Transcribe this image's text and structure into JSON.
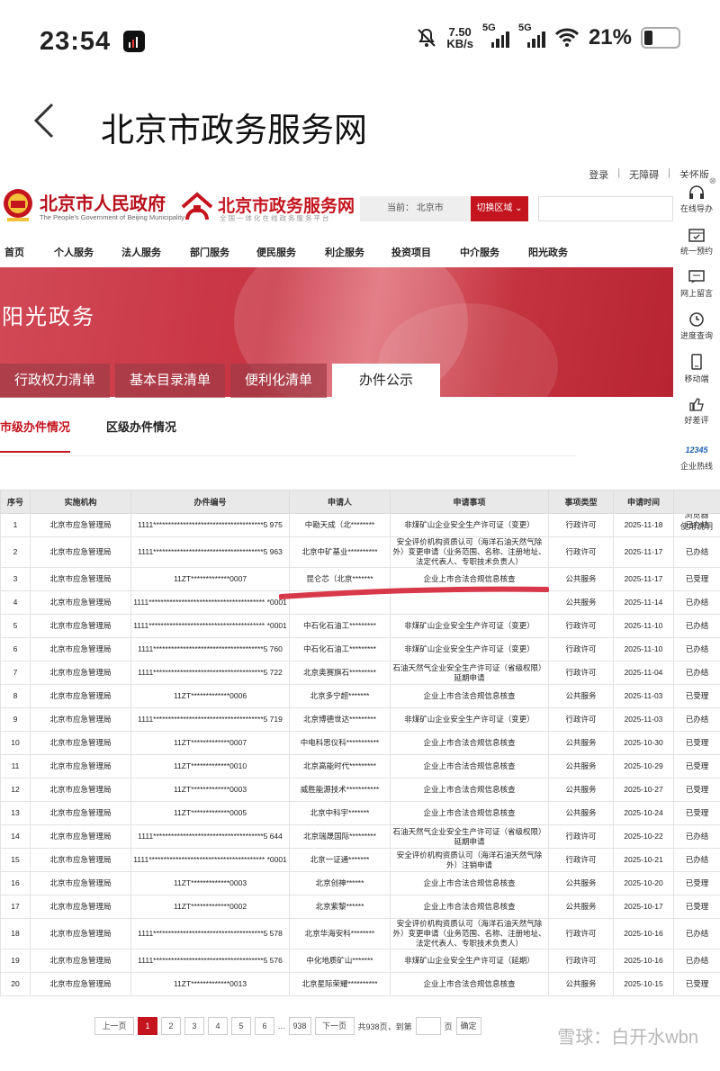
{
  "status_bar": {
    "time": "23:54",
    "speed_value": "7.50",
    "speed_unit": "KB/s",
    "signal1": "5G",
    "signal2": "5G",
    "battery": "21%"
  },
  "header": {
    "title": "北京市政务服务网"
  },
  "site": {
    "top_links": [
      "登录",
      "无障碍",
      "关怀版"
    ],
    "gov_name": "北京市人民政府",
    "gov_en": "The People's Government of Beijing Municipality",
    "service_name": "北京市政务服务网",
    "service_sub": "全国一体化在线政务服务平台",
    "region_label": "当前：",
    "region_value": "北京市",
    "region_button": "切换区域",
    "nav": [
      "首页",
      "个人服务",
      "法人服务",
      "部门服务",
      "便民服务",
      "利企服务",
      "投资项目",
      "中介服务",
      "阳光政务"
    ],
    "banner_title": "阳光政务",
    "tabs": [
      "行政权力清单",
      "基本目录清单",
      "便利化清单",
      "办件公示"
    ],
    "subtabs": [
      "市级办件情况",
      "区级办件情况"
    ],
    "sidebar": [
      "在线导办",
      "统一预约",
      "网上留言",
      "进度查询",
      "移动端",
      "好差评",
      "企业热线",
      "浏览器",
      "使用说明"
    ],
    "sidebar_badge": "12345"
  },
  "table": {
    "headers": [
      "序号",
      "实施机构",
      "办件编号",
      "申请人",
      "申请事项",
      "事项类型",
      "申请时间",
      ""
    ],
    "rows": [
      [
        "1",
        "北京市应急管理局",
        "1111*************************************5 975",
        "中勘天成（北********",
        "非煤矿山企业安全生产许可证（变更）",
        "行政许可",
        "2025-11-18",
        "已办结"
      ],
      [
        "2",
        "北京市应急管理局",
        "1111*************************************5 963",
        "北京中矿基业**********",
        "安全评价机构资质认可（海洋石油天然气除外）变更申请（业务范围、名称、注册地址、法定代表人、专职技术负责人）",
        "行政许可",
        "2025-11-17",
        "已办结"
      ],
      [
        "3",
        "北京市应急管理局",
        "11ZT*************0007",
        "昆仑芯（北京*******",
        "企业上市合法合规信息核查",
        "公共服务",
        "2025-11-17",
        "已受理"
      ],
      [
        "4",
        "北京市应急管理局",
        "1111*************************************** *0001",
        "",
        "",
        "公共服务",
        "2025-11-14",
        "已办结"
      ],
      [
        "5",
        "北京市应急管理局",
        "1111*************************************** *0001",
        "中石化石油工*********",
        "非煤矿山企业安全生产许可证（变更）",
        "行政许可",
        "2025-11-10",
        "已办结"
      ],
      [
        "6",
        "北京市应急管理局",
        "1111*************************************5 760",
        "中石化石油工*********",
        "非煤矿山企业安全生产许可证（变更）",
        "行政许可",
        "2025-11-10",
        "已办结"
      ],
      [
        "7",
        "北京市应急管理局",
        "1111*************************************5 722",
        "北京奥赛旗石*********",
        "石油天然气企业安全生产许可证（省级权限）延期申请",
        "行政许可",
        "2025-11-04",
        "已办结"
      ],
      [
        "8",
        "北京市应急管理局",
        "11ZT*************0006",
        "北京多宁超*******",
        "企业上市合法合规信息核查",
        "公共服务",
        "2025-11-03",
        "已受理"
      ],
      [
        "9",
        "北京市应急管理局",
        "1111*************************************5 719",
        "北京博德世达*********",
        "非煤矿山企业安全生产许可证（变更）",
        "行政许可",
        "2025-11-03",
        "已办结"
      ],
      [
        "10",
        "北京市应急管理局",
        "11ZT*************0007",
        "中电科思仪科***********",
        "企业上市合法合规信息核查",
        "公共服务",
        "2025-10-30",
        "已受理"
      ],
      [
        "11",
        "北京市应急管理局",
        "11ZT*************0010",
        "北京高能时代*********",
        "企业上市合法合规信息核查",
        "公共服务",
        "2025-10-29",
        "已受理"
      ],
      [
        "12",
        "北京市应急管理局",
        "11ZT*************0003",
        "威胜能源技术***********",
        "企业上市合法合规信息核查",
        "公共服务",
        "2025-10-27",
        "已受理"
      ],
      [
        "13",
        "北京市应急管理局",
        "11ZT*************0005",
        "北京中科宇*******",
        "企业上市合法合规信息核查",
        "公共服务",
        "2025-10-24",
        "已受理"
      ],
      [
        "14",
        "北京市应急管理局",
        "1111*************************************5 644",
        "北京瑞晟国际*********",
        "石油天然气企业安全生产许可证（省级权限）延期申请",
        "行政许可",
        "2025-10-22",
        "已办结"
      ],
      [
        "15",
        "北京市应急管理局",
        "1111*************************************** *0001",
        "北京一证通*******",
        "安全评价机构资质认可（海洋石油天然气除外）注销申请",
        "行政许可",
        "2025-10-21",
        "已办结"
      ],
      [
        "16",
        "北京市应急管理局",
        "11ZT*************0003",
        "北京创神******",
        "企业上市合法合规信息核查",
        "公共服务",
        "2025-10-20",
        "已受理"
      ],
      [
        "17",
        "北京市应急管理局",
        "11ZT*************0002",
        "北京紫黎******",
        "企业上市合法合规信息核查",
        "公共服务",
        "2025-10-17",
        "已受理"
      ],
      [
        "18",
        "北京市应急管理局",
        "1111*************************************5 578",
        "北京华海安科********",
        "安全评价机构资质认可（海洋石油天然气除外）变更申请（业务范围、名称、注册地址、法定代表人、专职技术负责人）",
        "行政许可",
        "2025-10-16",
        "已办结"
      ],
      [
        "19",
        "北京市应急管理局",
        "1111*************************************5 576",
        "中化地质矿山*******",
        "非煤矿山企业安全生产许可证（延期）",
        "行政许可",
        "2025-10-16",
        "已办结"
      ],
      [
        "20",
        "北京市应急管理局",
        "11ZT*************0013",
        "北京星际荣耀**********",
        "企业上市合法合规信息核查",
        "公共服务",
        "2025-10-15",
        "已受理"
      ]
    ]
  },
  "pager": {
    "prev": "上一页",
    "pages": [
      "1",
      "2",
      "3",
      "4",
      "5",
      "6"
    ],
    "ellipsis": "...",
    "last": "938",
    "next": "下一页",
    "total": "共938页，到第",
    "page_unit": "页",
    "confirm": "确定"
  },
  "watermark": "雪球：白开水wbn",
  "colors": {
    "brand_red": "#c4141e",
    "banner_red": "#c83342"
  }
}
